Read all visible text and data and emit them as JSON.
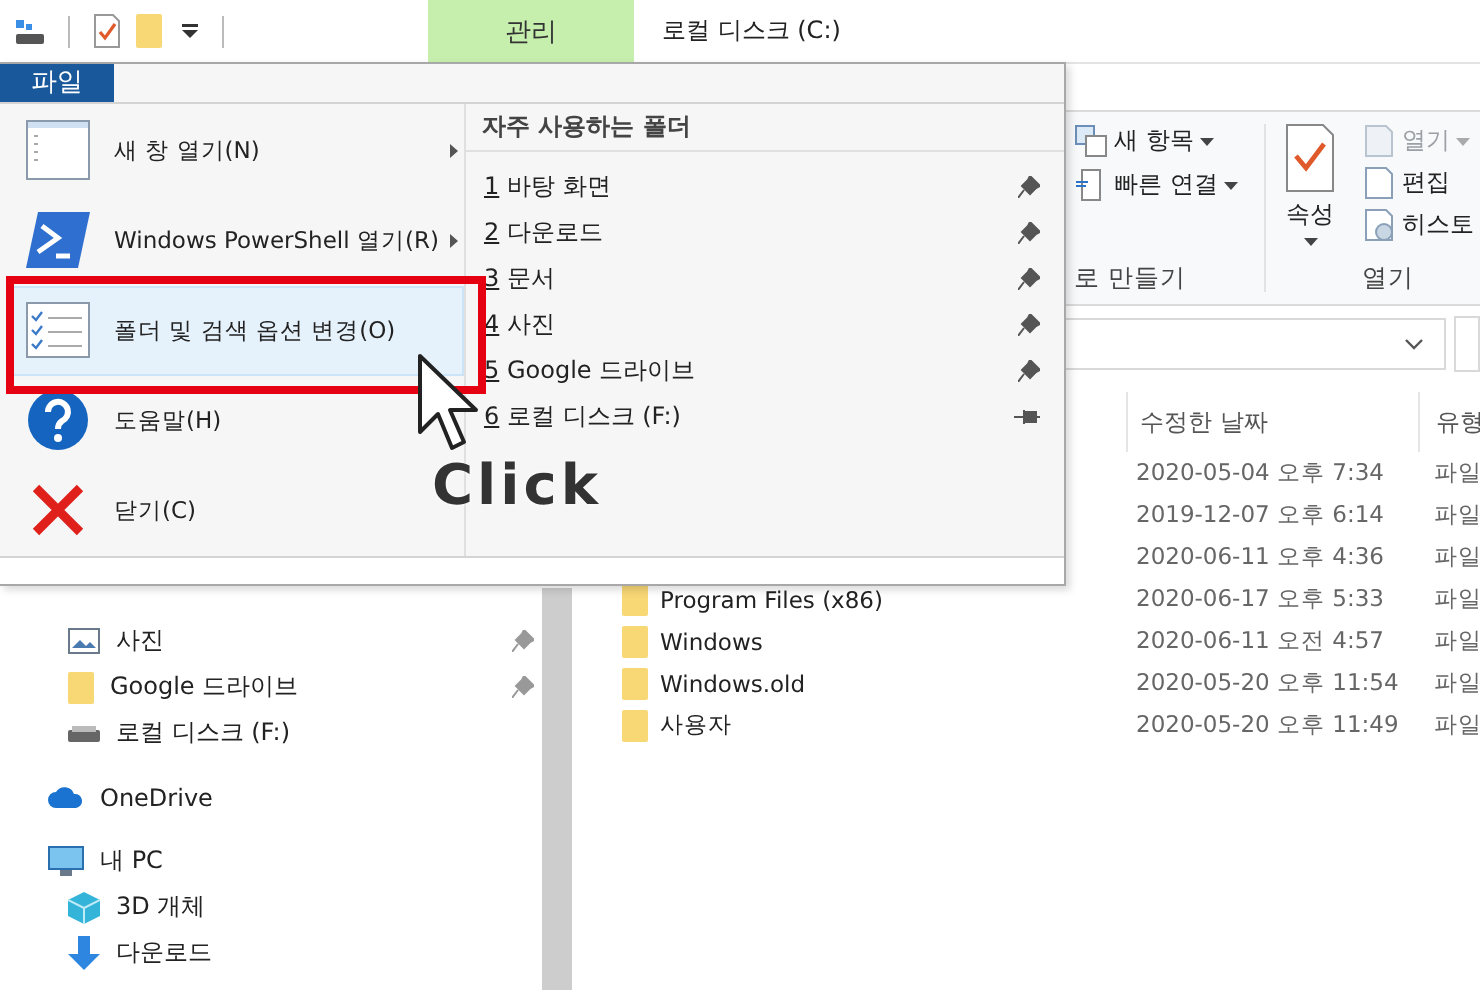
{
  "title_bar": {
    "context_tab": "관리",
    "title": "로컬 디스크 (C:)"
  },
  "ribbon": {
    "new_group": {
      "label": "로 만들기",
      "commands": [
        "새 항목",
        "빠른 연결"
      ]
    },
    "open_group": {
      "label": "열기",
      "properties": "속성",
      "commands": [
        {
          "label": "열기",
          "disabled": true
        },
        {
          "label": "편집",
          "disabled": false
        },
        {
          "label": "히스토",
          "disabled": false
        }
      ]
    }
  },
  "file_list": {
    "columns": [
      "수정한 날짜",
      "유형"
    ],
    "rows": [
      {
        "modified": "2020-05-04 오후 7:34",
        "type": "파일"
      },
      {
        "modified": "2019-12-07 오후 6:14",
        "type": "파일"
      },
      {
        "modified": "2020-06-11 오후 4:36",
        "type": "파일"
      },
      {
        "name": "Program Files (x86)",
        "modified": "2020-06-17 오후 5:33",
        "type": "파일"
      },
      {
        "name": "Windows",
        "modified": "2020-06-11 오전 4:57",
        "type": "파일"
      },
      {
        "name": "Windows.old",
        "modified": "2020-05-20 오후 11:54",
        "type": "파일"
      },
      {
        "name": "사용자",
        "modified": "2020-05-20 오후 11:49",
        "type": "파일"
      }
    ]
  },
  "navigation_pane": {
    "quick_access": [
      {
        "label": "사진",
        "pinned": true
      },
      {
        "label": "Google 드라이브",
        "pinned": true
      },
      {
        "label": "로컬 디스크 (F:)",
        "pinned": false
      }
    ],
    "tree": [
      {
        "label": "OneDrive"
      },
      {
        "label": "내 PC",
        "children": [
          {
            "label": "3D 개체"
          },
          {
            "label": "다운로드"
          }
        ]
      }
    ]
  },
  "file_menu": {
    "tab": {
      "label": "파일",
      "selected": true
    },
    "commands": [
      {
        "label": "새 창 열기(N)",
        "submenu": true,
        "selected": false
      },
      {
        "label": "Windows PowerShell 열기(R)",
        "submenu": true,
        "selected": false
      },
      {
        "label": "폴더 및 검색 옵션 변경(O)",
        "submenu": false,
        "selected": true
      },
      {
        "label": "도움말(H)",
        "submenu": false,
        "selected": false
      },
      {
        "label": "닫기(C)",
        "submenu": false,
        "selected": false
      }
    ],
    "frequent_header": "자주 사용하는 폴더",
    "frequent": [
      {
        "number": "1",
        "label": "바탕 화면",
        "pinned": true
      },
      {
        "number": "2",
        "label": "다운로드",
        "pinned": true
      },
      {
        "number": "3",
        "label": "문서",
        "pinned": true
      },
      {
        "number": "4",
        "label": "사진",
        "pinned": true
      },
      {
        "number": "5",
        "label": "Google 드라이브",
        "pinned": true
      },
      {
        "number": "6",
        "label": "로컬 디스크 (F:)",
        "pinned": false
      }
    ]
  },
  "annotation": {
    "label": "Click"
  }
}
